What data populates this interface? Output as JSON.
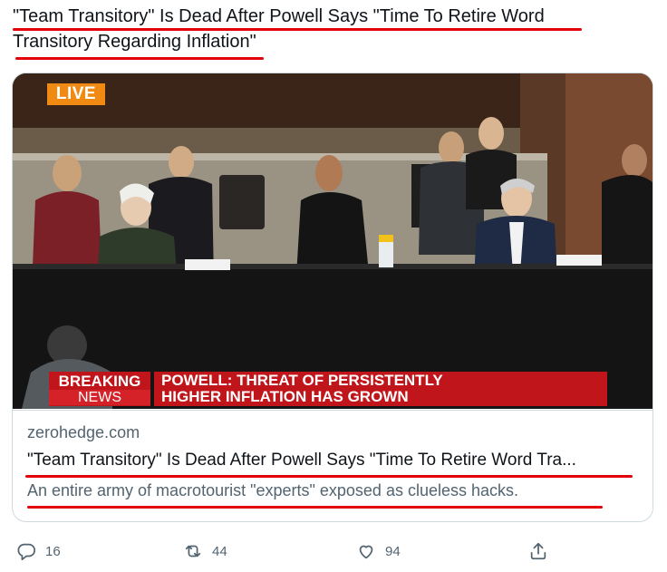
{
  "tweet": {
    "text_line1": "\"Team Transitory\" Is Dead After Powell Says \"Time To Retire Word",
    "text_line2": "Transitory Regarding Inflation\""
  },
  "media": {
    "live_badge": "LIVE",
    "breaking_line1": "BREAKING",
    "breaking_line2": "NEWS",
    "headline_line1": "POWELL: THREAT OF PERSISTENTLY",
    "headline_line2": "HIGHER INFLATION HAS GROWN"
  },
  "card": {
    "domain": "zerohedge.com",
    "title": "\"Team Transitory\" Is Dead After Powell Says \"Time To Retire Word Tra...",
    "description": "An entire army of macrotourist \"experts\" exposed as clueless hacks."
  },
  "actions": {
    "reply_count": "16",
    "retweet_count": "44",
    "like_count": "94"
  },
  "colors": {
    "underline": "#e3000b",
    "muted": "#536471",
    "text": "#0f1419",
    "breaking_red": "#c0161b",
    "live_orange": "#f08a13"
  }
}
